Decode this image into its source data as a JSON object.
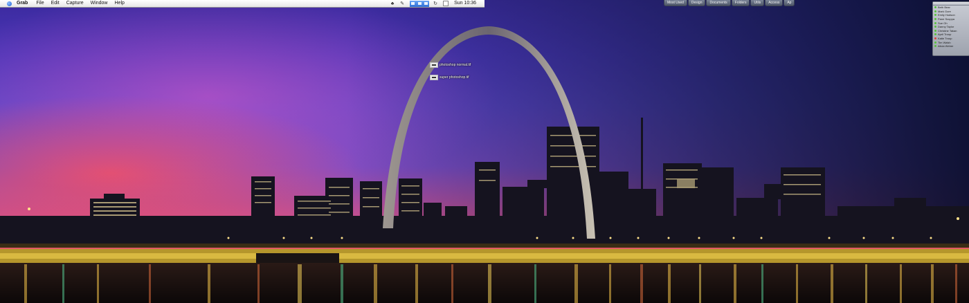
{
  "menubar": {
    "app_name": "Grab",
    "menus": [
      "File",
      "Edit",
      "Capture",
      "Window",
      "Help"
    ],
    "clock": "Sun 10:36",
    "icons": [
      "apple-icon",
      "stuffit-icon",
      "script-icon",
      "input-menu-icon",
      "sync-icon",
      "checkbox-icon"
    ]
  },
  "tabs": [
    "Most Used",
    "Design",
    "Documents",
    "Folders",
    "Utils",
    "Access",
    "Ap"
  ],
  "buddy_list": {
    "buddies": [
      {
        "name": "Beth Bear",
        "status": "#55c23a"
      },
      {
        "name": "Mark Gore",
        "status": "#55c23a"
      },
      {
        "name": "Emily Hudson",
        "status": "#55c23a"
      },
      {
        "name": "Pane Scuppa",
        "status": "#55c23a"
      },
      {
        "name": "Sue Oh",
        "status": "#55c23a"
      },
      {
        "name": "Danny Taylor",
        "status": "#55c23a"
      },
      {
        "name": "Christine Takan",
        "status": "#55c23a"
      },
      {
        "name": "April Troup",
        "status": "#55c23a"
      },
      {
        "name": "Katie Troup",
        "status": "#d8443c"
      },
      {
        "name": "Tim Walsh",
        "status": "#55c23a"
      },
      {
        "name": "Alicia Weber",
        "status": "#55c23a"
      }
    ]
  },
  "desktop_items": [
    {
      "label": "photoshop normal.tif"
    },
    {
      "label": "super photoshop.tif"
    }
  ]
}
